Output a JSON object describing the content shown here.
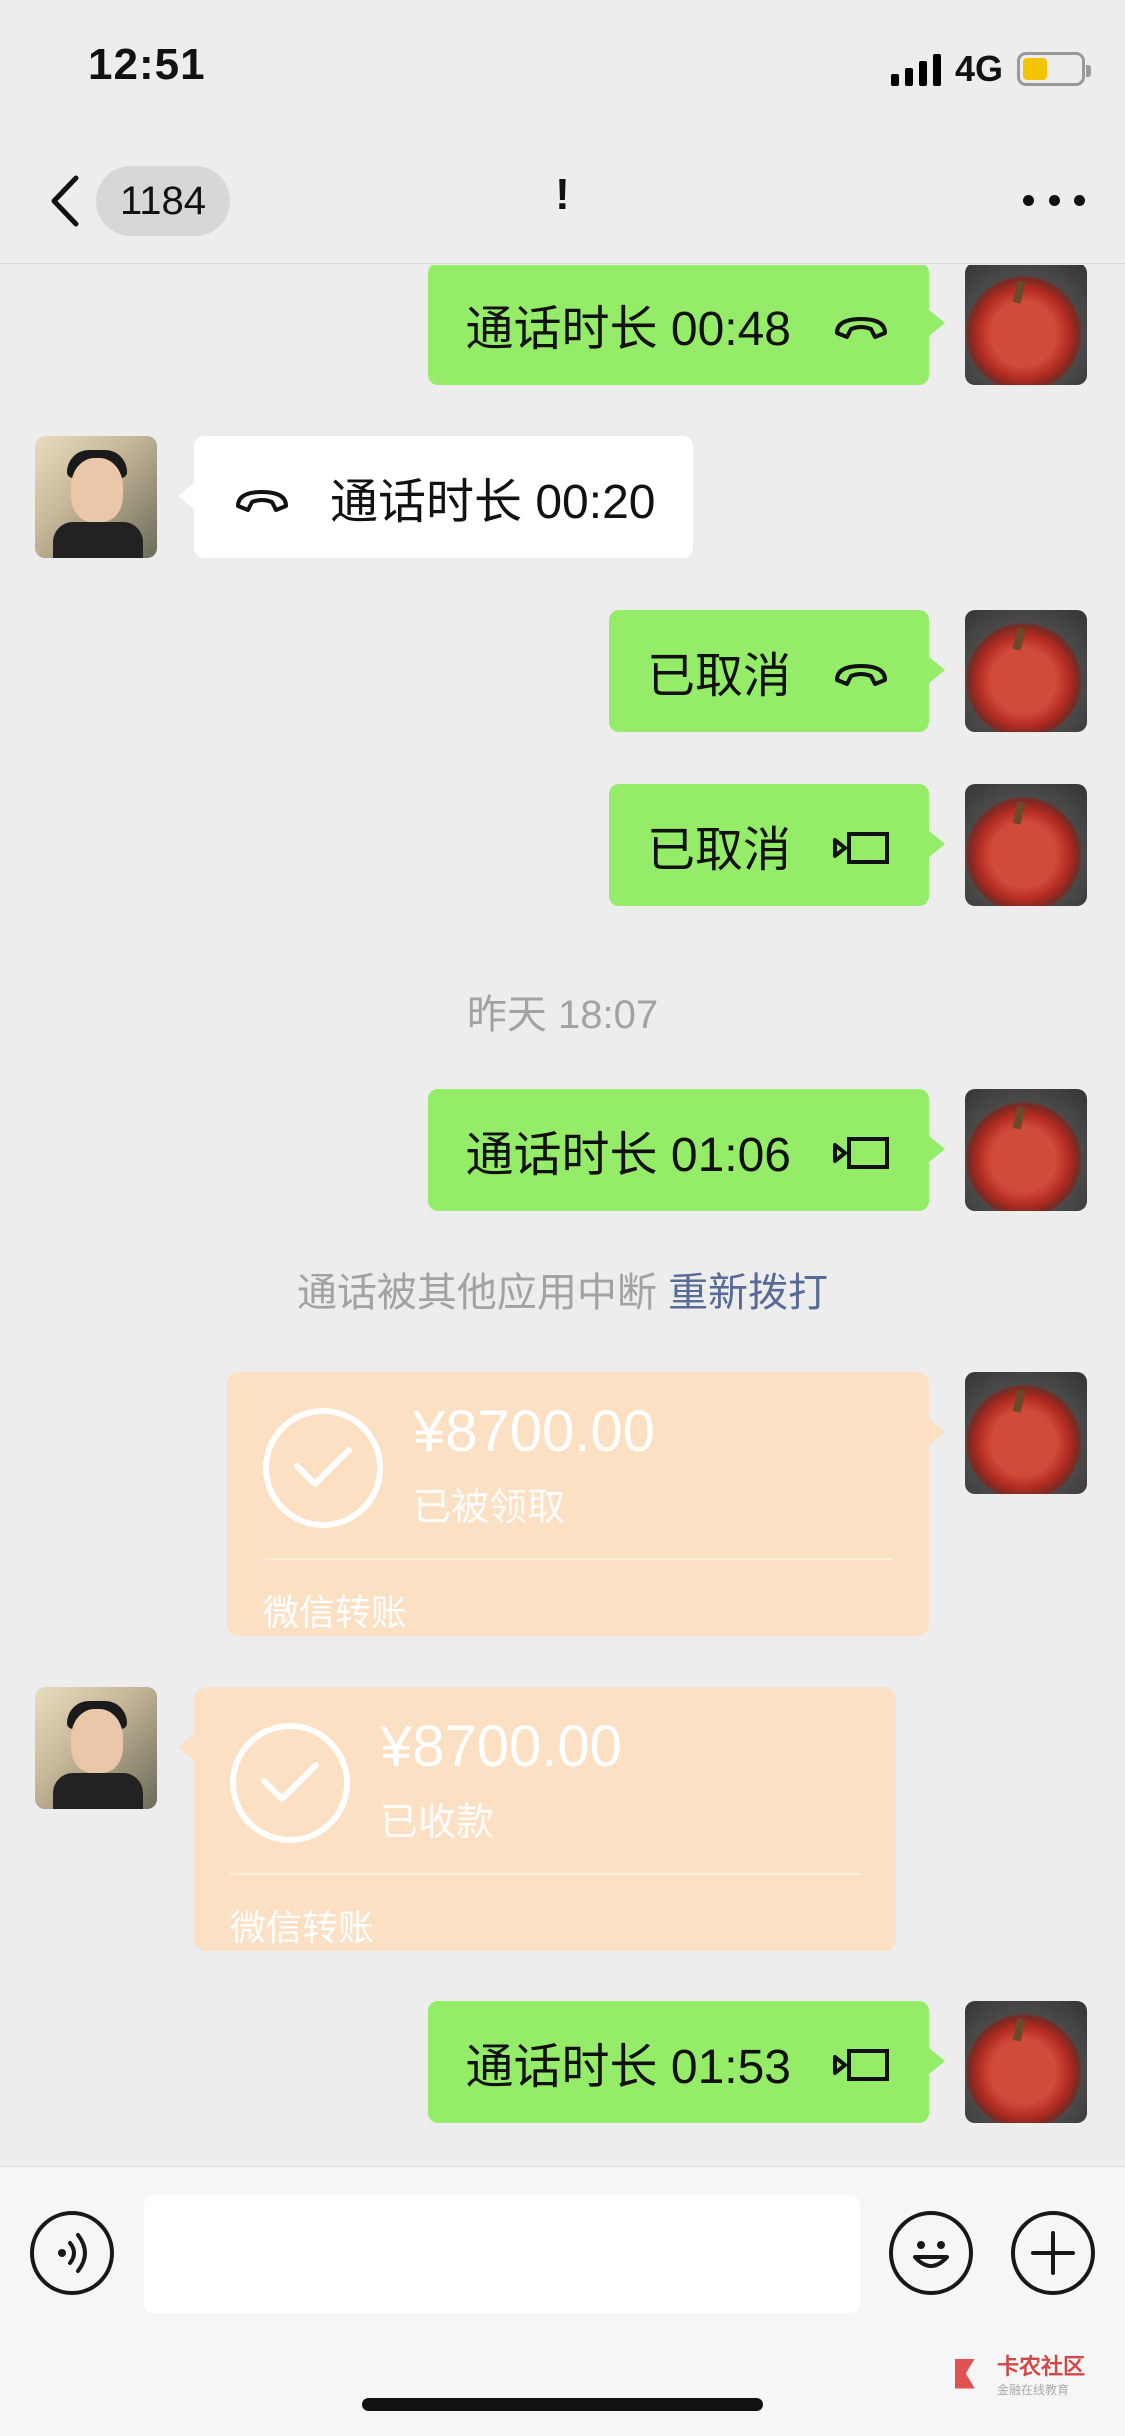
{
  "status_bar": {
    "time": "12:51",
    "network": "4G",
    "battery_color": "#f5c400"
  },
  "nav": {
    "unread_count": "1184",
    "title": "!"
  },
  "messages": [
    {
      "type": "call",
      "side": "out",
      "text": "通话时长 00:48",
      "icon": "phone-hangup-icon"
    },
    {
      "type": "call",
      "side": "in",
      "text": "通话时长 00:20",
      "icon": "phone-hangup-icon"
    },
    {
      "type": "call",
      "side": "out",
      "text": "已取消",
      "icon": "phone-hangup-icon"
    },
    {
      "type": "call",
      "side": "out",
      "text": "已取消",
      "icon": "video-camera-icon"
    },
    {
      "type": "timestamp",
      "text": "昨天 18:07"
    },
    {
      "type": "call",
      "side": "out",
      "text": "通话时长 01:06",
      "icon": "video-camera-icon"
    },
    {
      "type": "system",
      "text": "通话被其他应用中断",
      "link": "重新拨打"
    },
    {
      "type": "transfer",
      "side": "out",
      "amount": "¥8700.00",
      "status": "已被领取",
      "label": "微信转账"
    },
    {
      "type": "transfer",
      "side": "in",
      "amount": "¥8700.00",
      "status": "已收款",
      "label": "微信转账"
    },
    {
      "type": "call",
      "side": "out",
      "text": "通话时长 01:53",
      "icon": "video-camera-icon"
    }
  ],
  "input_bar": {
    "placeholder": "",
    "value": ""
  },
  "watermark": {
    "title": "卡农社区",
    "subtitle": "金融在线教育"
  },
  "colors": {
    "outgoing_bubble": "#95ec69",
    "incoming_bubble": "#ffffff",
    "transfer_card": "#fbe0c3",
    "link": "#576b95",
    "background": "#ededed"
  }
}
